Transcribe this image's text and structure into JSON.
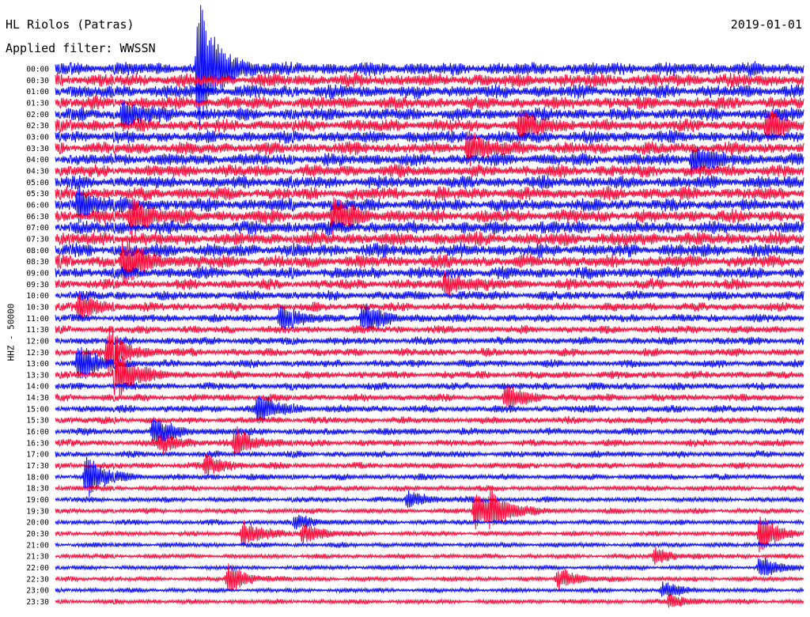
{
  "header": {
    "station": "HL Riolos (Patras)",
    "filter": "Applied filter: WWSSN",
    "date": "2019-01-01"
  },
  "chart_data": {
    "type": "line",
    "title": "HL Riolos (Patras)",
    "subtitle": "Applied filter: WWSSN",
    "ylabel": "HHZ - 50000",
    "colors": [
      "#0000ff",
      "#ff0033"
    ],
    "y_tick_labels": [
      "00:00",
      "00:30",
      "01:00",
      "01:30",
      "02:00",
      "02:30",
      "03:00",
      "03:30",
      "04:00",
      "04:30",
      "05:00",
      "05:30",
      "06:00",
      "06:30",
      "07:00",
      "07:30",
      "08:00",
      "08:30",
      "09:00",
      "09:30",
      "10:00",
      "10:30",
      "11:00",
      "11:30",
      "12:00",
      "12:30",
      "13:00",
      "13:30",
      "14:00",
      "14:30",
      "15:00",
      "15:30",
      "16:00",
      "16:30",
      "17:00",
      "17:30",
      "18:00",
      "18:30",
      "19:00",
      "19:30",
      "20:00",
      "20:30",
      "21:00",
      "21:30",
      "22:00",
      "22:30",
      "23:00",
      "23:30"
    ],
    "noise_level": [
      10,
      10,
      10,
      9.6,
      9.6,
      9.4,
      9.2,
      9.2,
      9.4,
      9.4,
      9.6,
      9.6,
      9.6,
      10,
      10,
      10,
      10,
      9.6,
      9,
      7.8,
      7,
      6.6,
      6.2,
      6,
      6,
      6,
      5.8,
      5.8,
      5.6,
      5.6,
      5.6,
      5.4,
      5.4,
      5.2,
      5,
      4.8,
      4.6,
      4.4,
      4.2,
      4,
      4,
      3.8,
      3.8,
      3.6,
      3.6,
      3.6,
      3.6,
      3.6
    ],
    "events": [
      {
        "row": 0,
        "x": 0.19,
        "amp": 90
      },
      {
        "row": 4,
        "x": 0.09,
        "amp": 20
      },
      {
        "row": 5,
        "x": 0.62,
        "amp": 18
      },
      {
        "row": 5,
        "x": 0.95,
        "amp": 20
      },
      {
        "row": 7,
        "x": 0.55,
        "amp": 22
      },
      {
        "row": 8,
        "x": 0.85,
        "amp": 20
      },
      {
        "row": 12,
        "x": 0.03,
        "amp": 22
      },
      {
        "row": 13,
        "x": 0.1,
        "amp": 30
      },
      {
        "row": 13,
        "x": 0.37,
        "amp": 24
      },
      {
        "row": 17,
        "x": 0.09,
        "amp": 34
      },
      {
        "row": 19,
        "x": 0.52,
        "amp": 16
      },
      {
        "row": 21,
        "x": 0.03,
        "amp": 18
      },
      {
        "row": 22,
        "x": 0.3,
        "amp": 18
      },
      {
        "row": 22,
        "x": 0.41,
        "amp": 20
      },
      {
        "row": 25,
        "x": 0.07,
        "amp": 30
      },
      {
        "row": 26,
        "x": 0.03,
        "amp": 28
      },
      {
        "row": 27,
        "x": 0.08,
        "amp": 34
      },
      {
        "row": 29,
        "x": 0.6,
        "amp": 16
      },
      {
        "row": 30,
        "x": 0.27,
        "amp": 22
      },
      {
        "row": 32,
        "x": 0.13,
        "amp": 18
      },
      {
        "row": 33,
        "x": 0.24,
        "amp": 20
      },
      {
        "row": 33,
        "x": 0.14,
        "amp": 14
      },
      {
        "row": 35,
        "x": 0.2,
        "amp": 14
      },
      {
        "row": 36,
        "x": 0.04,
        "amp": 30
      },
      {
        "row": 38,
        "x": 0.47,
        "amp": 12
      },
      {
        "row": 39,
        "x": 0.56,
        "amp": 26
      },
      {
        "row": 39,
        "x": 0.58,
        "amp": 20
      },
      {
        "row": 40,
        "x": 0.32,
        "amp": 10
      },
      {
        "row": 41,
        "x": 0.25,
        "amp": 18
      },
      {
        "row": 41,
        "x": 0.33,
        "amp": 14
      },
      {
        "row": 41,
        "x": 0.94,
        "amp": 26
      },
      {
        "row": 43,
        "x": 0.8,
        "amp": 12
      },
      {
        "row": 44,
        "x": 0.94,
        "amp": 14
      },
      {
        "row": 45,
        "x": 0.23,
        "amp": 20
      },
      {
        "row": 45,
        "x": 0.67,
        "amp": 16
      },
      {
        "row": 46,
        "x": 0.81,
        "amp": 10
      },
      {
        "row": 47,
        "x": 0.82,
        "amp": 10
      }
    ]
  }
}
